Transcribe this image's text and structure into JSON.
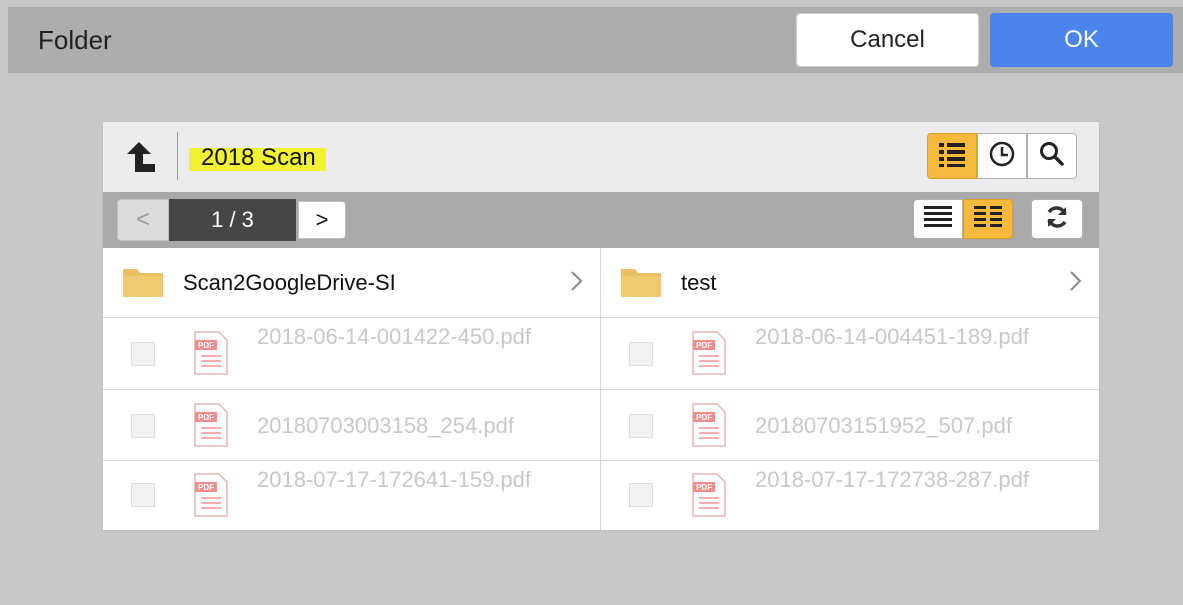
{
  "dialog": {
    "title": "Folder",
    "cancel_label": "Cancel",
    "ok_label": "OK"
  },
  "pathbar": {
    "current_path": "2018 Scan",
    "up_icon": "arrow-up-icon",
    "view_buttons": [
      {
        "icon": "list-icon",
        "active": true
      },
      {
        "icon": "clock-icon",
        "active": false
      },
      {
        "icon": "search-icon",
        "active": false
      }
    ]
  },
  "navbar": {
    "prev_label": "<",
    "page_indicator": "1 / 3",
    "next_label": ">",
    "layout_buttons": [
      {
        "icon": "single-column-icon",
        "active": false
      },
      {
        "icon": "two-column-icon",
        "active": true
      }
    ],
    "refresh_icon": "refresh-icon"
  },
  "folders": [
    {
      "name": "Scan2GoogleDrive-SI"
    },
    {
      "name": "test"
    }
  ],
  "files": [
    {
      "name": "2018-06-14-001422-450.pdf"
    },
    {
      "name": "2018-06-14-004451-189.pdf"
    },
    {
      "name": "20180703003158_254.pdf"
    },
    {
      "name": "20180703151952_507.pdf"
    },
    {
      "name": "2018-07-17-172641-159.pdf"
    },
    {
      "name": "2018-07-17-172738-287.pdf"
    }
  ],
  "colors": {
    "ok_button": "#4b84ec",
    "active_toggle": "#f6b93b",
    "folder": "#e8c063",
    "pdf_badge": "#f08c8c",
    "path_highlight": "#f1f231"
  }
}
